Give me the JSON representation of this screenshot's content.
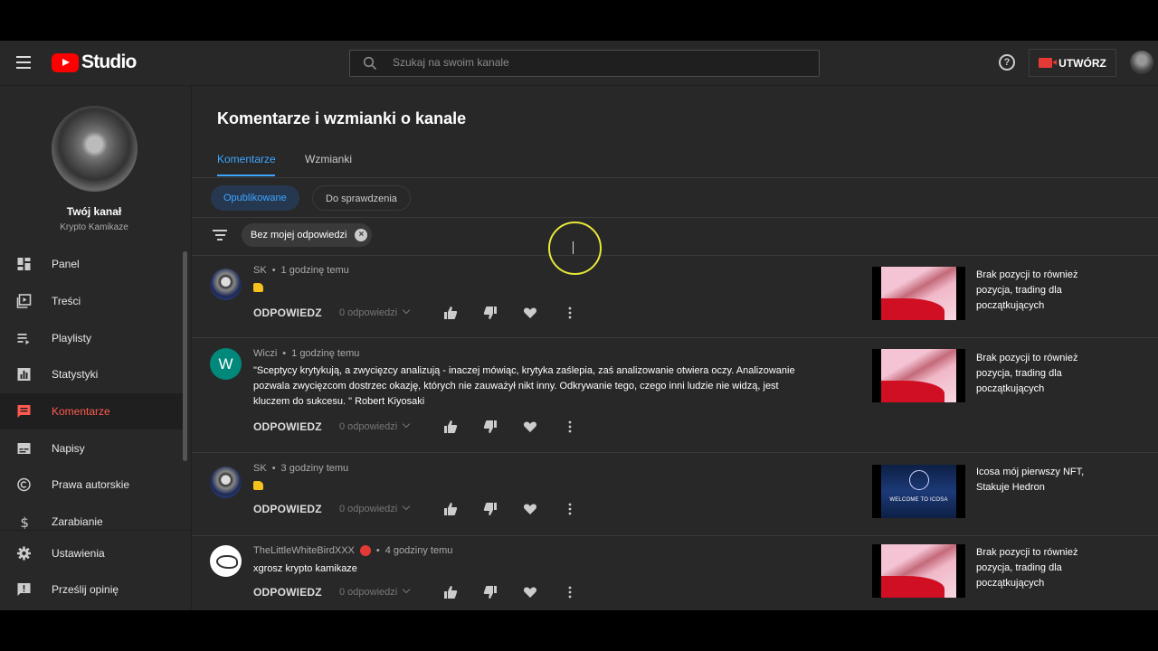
{
  "header": {
    "logo_text": "Studio",
    "search_placeholder": "Szukaj na swoim kanale",
    "create_label": "UTWÓRZ"
  },
  "sidebar": {
    "channel_title": "Twój kanał",
    "channel_name": "Krypto Kamikaze",
    "items": [
      {
        "label": "Panel",
        "icon": "dashboard-icon"
      },
      {
        "label": "Treści",
        "icon": "content-icon"
      },
      {
        "label": "Playlisty",
        "icon": "playlist-icon"
      },
      {
        "label": "Statystyki",
        "icon": "analytics-icon"
      },
      {
        "label": "Komentarze",
        "icon": "comments-icon"
      },
      {
        "label": "Napisy",
        "icon": "subtitles-icon"
      },
      {
        "label": "Prawa autorskie",
        "icon": "copyright-icon"
      },
      {
        "label": "Zarabianie",
        "icon": "dollar-icon"
      },
      {
        "label": "Ustawienia",
        "icon": "gear-icon"
      },
      {
        "label": "Prześlij opinię",
        "icon": "feedback-icon"
      }
    ],
    "active_index": 4
  },
  "main": {
    "title": "Komentarze i wzmianki o kanale",
    "tabs": [
      "Komentarze",
      "Wzmianki"
    ],
    "chips": [
      "Opublikowane",
      "Do sprawdzenia"
    ],
    "filter_chip": "Bez mojej odpowiedzi",
    "reply_label": "ODPOWIEDZ",
    "comments": [
      {
        "author": "SK",
        "time": "1 godzinę temu",
        "text": "",
        "replies": "0 odpowiedzi",
        "video_title": "Brak pozycji to również pozycja, trading dla początkujących"
      },
      {
        "author": "Wiczi",
        "time": "1 godzinę temu",
        "text": "\"Sceptycy krytykują, a zwycięzcy analizują - inaczej mówiąc, krytyka zaślepia, zaś analizowanie otwiera oczy. Analizowanie pozwala zwycięzcom dostrzec okazję, których nie zauważył nikt inny. Odkrywanie tego, czego inni ludzie nie widzą, jest kluczem do sukcesu. \" Robert Kiyosaki",
        "replies": "0 odpowiedzi",
        "video_title": "Brak pozycji to również pozycja, trading dla początkujących"
      },
      {
        "author": "SK",
        "time": "3 godziny temu",
        "text": "",
        "replies": "0 odpowiedzi",
        "video_title": "Icosa mój pierwszy NFT, Stakuje Hedron",
        "thumb_caption": "WELCOME TO ICOSA"
      },
      {
        "author": "TheLittleWhiteBirdXXX",
        "time": "4 godziny temu",
        "text": "xgrosz krypto kamikaze",
        "replies": "0 odpowiedzi",
        "video_title": "Brak pozycji to również pozycja, trading dla początkujących"
      }
    ],
    "avatar_letter": "W"
  },
  "colors": {
    "accent_blue": "#3ea6ff",
    "active_red": "#ff5a4f",
    "brand_red": "#ff0000",
    "background": "#282828"
  }
}
